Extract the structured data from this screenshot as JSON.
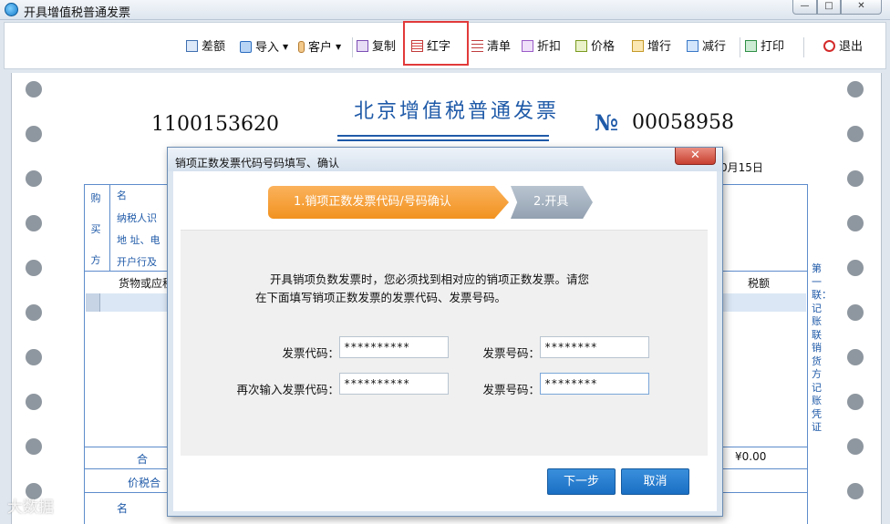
{
  "window": {
    "title": "开具增值税普通发票",
    "icon": "app-logo-icon",
    "controls": [
      "—",
      "□",
      "✕"
    ]
  },
  "toolbar": {
    "items": [
      {
        "label": "差额",
        "icon": "difference-icon"
      },
      {
        "label": "导入",
        "icon": "import-icon",
        "has_dropdown": true
      },
      {
        "label": "客户",
        "icon": "customer-icon",
        "has_dropdown": true
      },
      {
        "label": "复制",
        "icon": "copy-icon"
      },
      {
        "label": "红字",
        "icon": "red-invoice-icon",
        "highlighted": true
      },
      {
        "label": "清单",
        "icon": "list-icon"
      },
      {
        "label": "折扣",
        "icon": "discount-icon"
      },
      {
        "label": "价格",
        "icon": "price-icon"
      },
      {
        "label": "增行",
        "icon": "add-row-icon"
      },
      {
        "label": "减行",
        "icon": "delete-row-icon"
      },
      {
        "label": "打印",
        "icon": "print-icon"
      },
      {
        "label": "退出",
        "icon": "exit-icon"
      }
    ],
    "highlight_color": "#e23a3a"
  },
  "invoice": {
    "title": "北京增值税普通发票",
    "code": "1100153620",
    "no_label": "№",
    "number": "00058958",
    "date_partial": "0月15日",
    "buyer_section": [
      "购",
      "买",
      "方"
    ],
    "buyer_fields": [
      "名",
      "纳税人识",
      "地 址、电",
      "开户行及"
    ],
    "column_goods": "货物或应税",
    "column_tax": "税额",
    "total_label": "合",
    "total_tax": "¥0.00",
    "price_tax_total_label": "价税合",
    "seller_partial": "名",
    "side_label": "第一联：记账联 销货方记账凭证",
    "accent_color": "#1f5aa8"
  },
  "dialog": {
    "title": "销项正数发票代码号码填写、确认",
    "close_label": "✕",
    "steps": [
      {
        "label": "1.销项正数发票代码/号码确认",
        "active": true,
        "color": "#f19220"
      },
      {
        "label": "2.开具",
        "active": false,
        "color": "#93a1b1"
      }
    ],
    "instruction_line1": "开具销项负数发票时，您必须找到相对应的销项正数发票。请您",
    "instruction_line2": "在下面填写销项正数发票的发票代码、发票号码。",
    "fields": {
      "code_label": "发票代码：",
      "code_value": "**********",
      "number_label": "发票号码：",
      "number_value": "********",
      "code_again_label": "再次输入发票代码：",
      "code_again_value": "**********",
      "number_again_label": "发票号码：",
      "number_again_value": "********"
    },
    "next_button": "下一步",
    "cancel_button": "取消",
    "button_color": "#1b6fc4"
  },
  "watermark": "大数据"
}
